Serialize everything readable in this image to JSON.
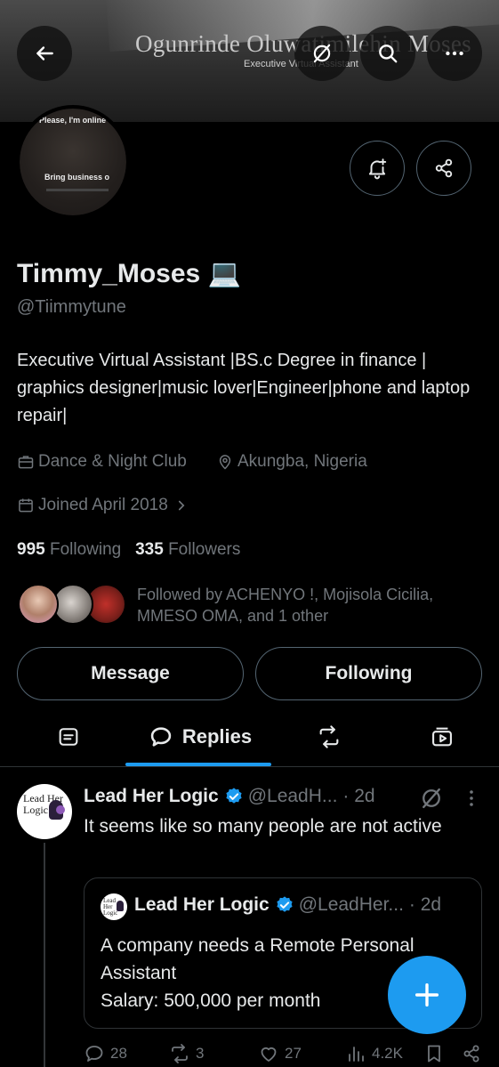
{
  "banner": {
    "title": "Ogunrinde Oluwatimilehin Moses",
    "subtitle": "Executive Virtual Assistant"
  },
  "avatar": {
    "text_top": "Please, I'm online",
    "text_bottom": "Bring business o"
  },
  "profile": {
    "display_name": "Timmy_Moses 💻",
    "handle": "@Tiimmytune",
    "bio": "Executive Virtual Assistant |BS.c Degree in finance | graphics designer|music lover|Engineer|phone and laptop repair|",
    "category": "Dance & Night Club",
    "location": "Akungba, Nigeria",
    "joined": "Joined April 2018",
    "following_count": "995",
    "following_label": "Following",
    "followers_count": "335",
    "followers_label": "Followers",
    "followed_by": "Followed by ACHENYO !, Mojisola Cicilia, MMESO OMA, and 1 other"
  },
  "buttons": {
    "message": "Message",
    "following": "Following"
  },
  "tabs": {
    "active_label": "Replies"
  },
  "post": {
    "author": "Lead Her Logic",
    "handle": "@LeadH...",
    "time": "· 2d",
    "text": "It seems like so many people are not active",
    "avatar_logo": "Lead Her Logic",
    "quote": {
      "author": "Lead Her Logic",
      "handle": "@LeadHer...",
      "time": "· 2d",
      "text_line1": "A company needs a Remote Personal Assistant",
      "text_line2": "Salary: 500,000 per month"
    },
    "actions": {
      "replies": "28",
      "reposts": "3",
      "likes": "27",
      "views": "4.2K"
    }
  },
  "colors": {
    "accent": "#1d9bf0",
    "muted": "#71767b",
    "border": "#536471",
    "background": "#000000"
  }
}
